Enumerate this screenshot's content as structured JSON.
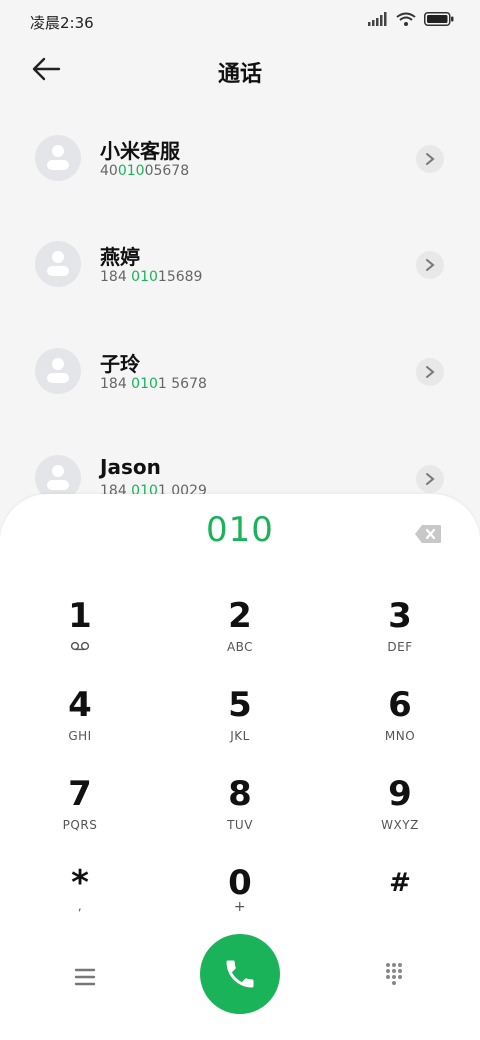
{
  "status_bar": {
    "time": "凌晨2:36"
  },
  "header": {
    "title": "通话"
  },
  "contacts": [
    {
      "name": "小米客服",
      "number_pre": "40",
      "number_match": "010",
      "number_post": "05678"
    },
    {
      "name": "燕婷",
      "number_pre": "184 ",
      "number_match": "010",
      "number_post": "15689"
    },
    {
      "name": "子玲",
      "number_pre": "184 ",
      "number_match": "010",
      "number_post": "1 5678"
    },
    {
      "name": "Jason",
      "number_pre": "184 ",
      "number_match": "010",
      "number_post": "1 0029"
    }
  ],
  "dialpad": {
    "dialed": "010",
    "keys": [
      {
        "digit": "1",
        "letters": ""
      },
      {
        "digit": "2",
        "letters": "ABC"
      },
      {
        "digit": "3",
        "letters": "DEF"
      },
      {
        "digit": "4",
        "letters": "GHI"
      },
      {
        "digit": "5",
        "letters": "JKL"
      },
      {
        "digit": "6",
        "letters": "MNO"
      },
      {
        "digit": "7",
        "letters": "PQRS"
      },
      {
        "digit": "8",
        "letters": "TUV"
      },
      {
        "digit": "9",
        "letters": "WXYZ"
      },
      {
        "digit": "*",
        "letters": ","
      },
      {
        "digit": "0",
        "letters": "+"
      },
      {
        "digit": "#",
        "letters": ""
      }
    ]
  },
  "colors": {
    "accent": "#1bb35a",
    "background": "#f5f5f5",
    "avatar": "#e3e5e8"
  },
  "icons": {
    "back": "arrow-left-icon",
    "chevron": "chevron-right-icon",
    "delete": "backspace-icon",
    "voicemail": "voicemail-icon",
    "menu": "menu-icon",
    "call": "phone-icon",
    "keypad": "keypad-icon"
  }
}
